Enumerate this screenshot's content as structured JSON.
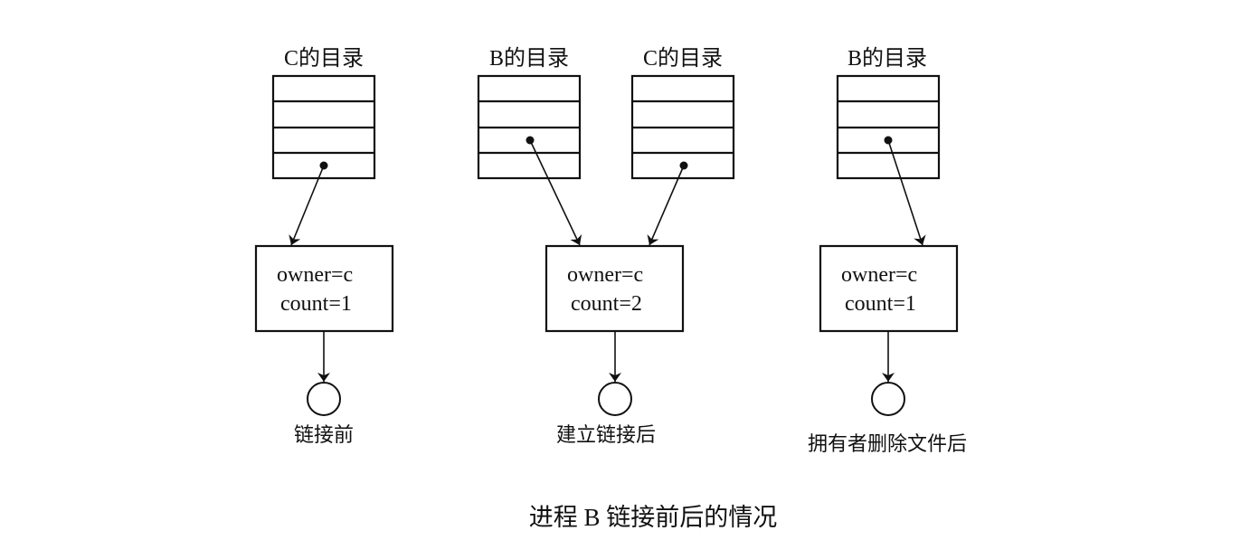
{
  "title": "进程 B 链接前后的情况",
  "panels": [
    {
      "caption": "链接前",
      "directories": [
        {
          "label": "C的目录",
          "entry_row": 4
        }
      ],
      "node": {
        "owner_line": "owner=c",
        "count_line": "count=1"
      }
    },
    {
      "caption": "建立链接后",
      "directories": [
        {
          "label": "B的目录",
          "entry_row": 3
        },
        {
          "label": "C的目录",
          "entry_row": 4
        }
      ],
      "node": {
        "owner_line": "owner=c",
        "count_line": "count=2"
      }
    },
    {
      "caption": "拥有者删除文件后",
      "directories": [
        {
          "label": "B的目录",
          "entry_row": 3
        }
      ],
      "node": {
        "owner_line": "owner=c",
        "count_line": "count=1"
      }
    }
  ],
  "directory_rows": 4
}
